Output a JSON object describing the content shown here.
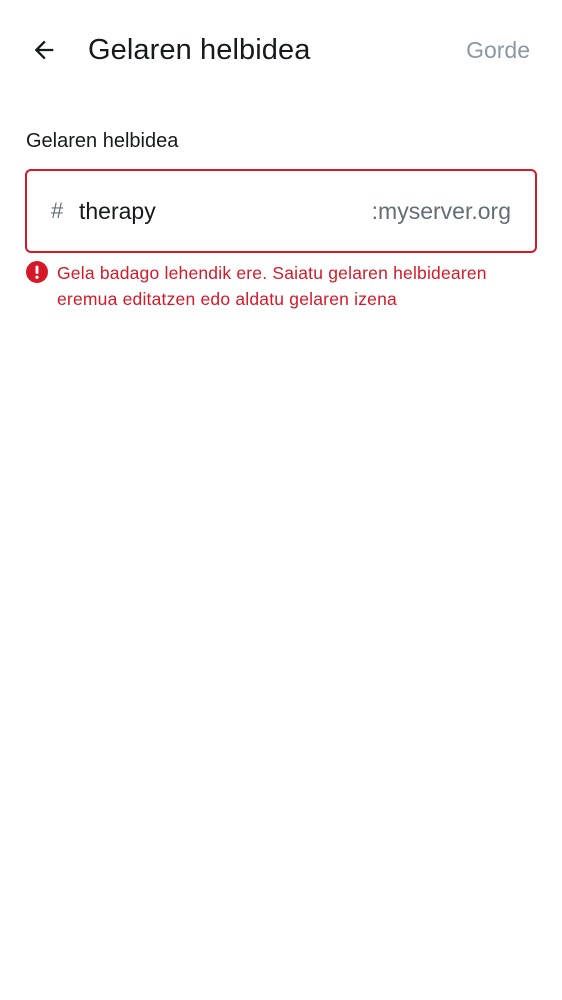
{
  "header": {
    "back_icon": "arrow-left-icon",
    "title": "Gelaren helbidea",
    "save_label": "Gorde"
  },
  "alias_field": {
    "label": "Gelaren helbidea",
    "prefix": "#",
    "value": "therapy",
    "server_suffix": ":myserver.org"
  },
  "error": {
    "icon": "error-circle-icon",
    "message": "Gela badago lehendik ere. Saiatu gelaren helbidearen eremua editatzen edo aldatu gelaren izena"
  },
  "colors": {
    "error": "#d51928",
    "text_primary": "#17191c",
    "text_secondary": "#656d77",
    "disabled_action": "#8d97a5"
  }
}
